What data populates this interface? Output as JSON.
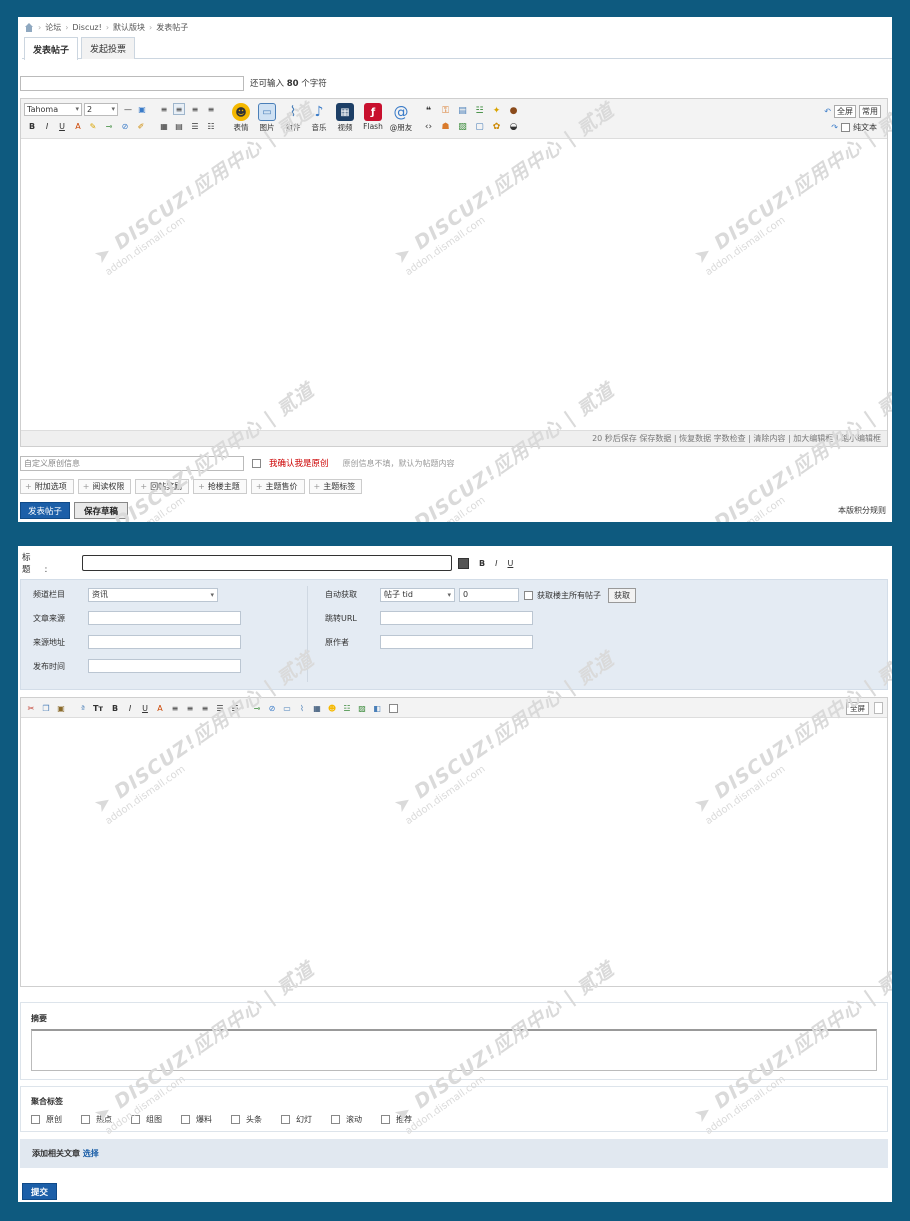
{
  "top": {
    "breadcrumb": [
      "论坛",
      "Discuz!",
      "默认版块",
      "发表帖子"
    ],
    "tabs": [
      {
        "label": "发表帖子",
        "active": true
      },
      {
        "label": "发起投票",
        "active": false
      }
    ],
    "subject_hint_prefix": "还可输入",
    "subject_hint_count": "80",
    "subject_hint_suffix": "个字符",
    "toolbar": {
      "font": "Tahoma",
      "size": "2",
      "media_buttons": [
        "表情",
        "图片",
        "附件",
        "音乐",
        "视频",
        "Flash",
        "@朋友"
      ],
      "fullscreen": "全屏",
      "common": "常用",
      "plain_text": "纯文本"
    },
    "status_bar": "20 秒后保存 保存数据 | 恢复数据    字数检查 | 清除内容 | 加大编辑框 | 缩小编辑框",
    "original_placeholder": "自定义原创信息",
    "original_confirm": "我确认我是原创",
    "original_note": "原创信息不填，默认为帖题内容",
    "options": [
      "附加选项",
      "阅读权限",
      "回帖奖励",
      "抢楼主题",
      "主题售价",
      "主题标签"
    ],
    "submit": "发表帖子",
    "save_draft": "保存草稿",
    "rules_link": "本版积分规则"
  },
  "bottom": {
    "title_label": "标题:",
    "title_tools": [
      "B",
      "I",
      "U"
    ],
    "meta": {
      "channel_label": "频道栏目",
      "channel_value": "资讯",
      "source_label": "文章来源",
      "source_url_label": "来源地址",
      "publish_time_label": "发布时间",
      "auto_fetch_label": "自动获取",
      "auto_fetch_select": "帖子 tid",
      "auto_fetch_value": "0",
      "fetch_all_label": "获取楼主所有帖子",
      "fetch_button": "获取",
      "jump_url_label": "跳转URL",
      "original_author_label": "原作者"
    },
    "fullscreen": "全屏",
    "summary_label": "摘要",
    "tags_label": "聚合标签",
    "tags": [
      "原创",
      "热点",
      "组图",
      "爆料",
      "头条",
      "幻灯",
      "滚动",
      "推荐"
    ],
    "related_label": "添加相关文章",
    "related_link": "选择",
    "submit": "提交"
  },
  "watermark": {
    "brand": "DISCUZ!应用中心",
    "domain": "addon.dismall.com",
    "tag": "贰道"
  },
  "colors": {
    "background": "#0e5a7f",
    "primary": "#1c5fa8",
    "meta_bg": "#e4ebf3",
    "confirm_red": "#cc0000"
  }
}
